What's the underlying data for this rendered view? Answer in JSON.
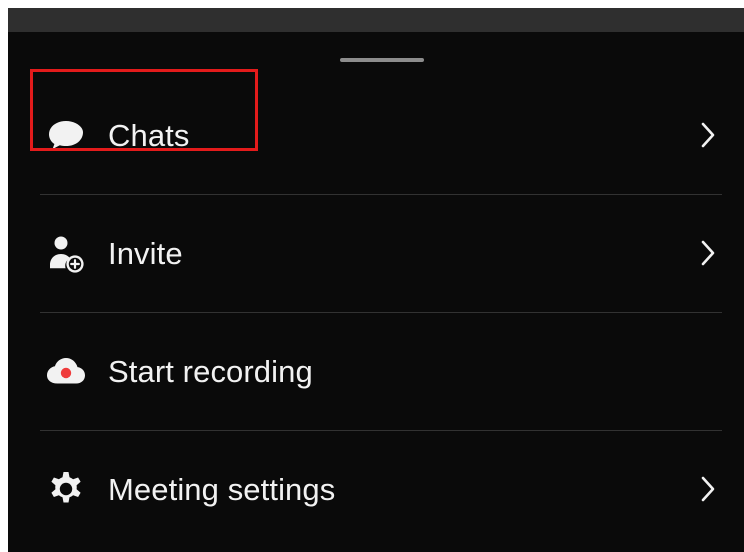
{
  "menu": {
    "items": [
      {
        "label": "Chats",
        "icon": "chat-bubble-icon",
        "has_chevron": true,
        "highlighted": true
      },
      {
        "label": "Invite",
        "icon": "invite-user-icon",
        "has_chevron": true,
        "highlighted": false
      },
      {
        "label": "Start recording",
        "icon": "cloud-record-icon",
        "has_chevron": false,
        "highlighted": false
      },
      {
        "label": "Meeting settings",
        "icon": "gear-icon",
        "has_chevron": true,
        "highlighted": false
      }
    ]
  },
  "colors": {
    "background": "#0a0a0a",
    "text": "#f2f2f2",
    "divider": "#323232",
    "highlight": "#e31b1b",
    "record_dot": "#ef3b3b"
  }
}
